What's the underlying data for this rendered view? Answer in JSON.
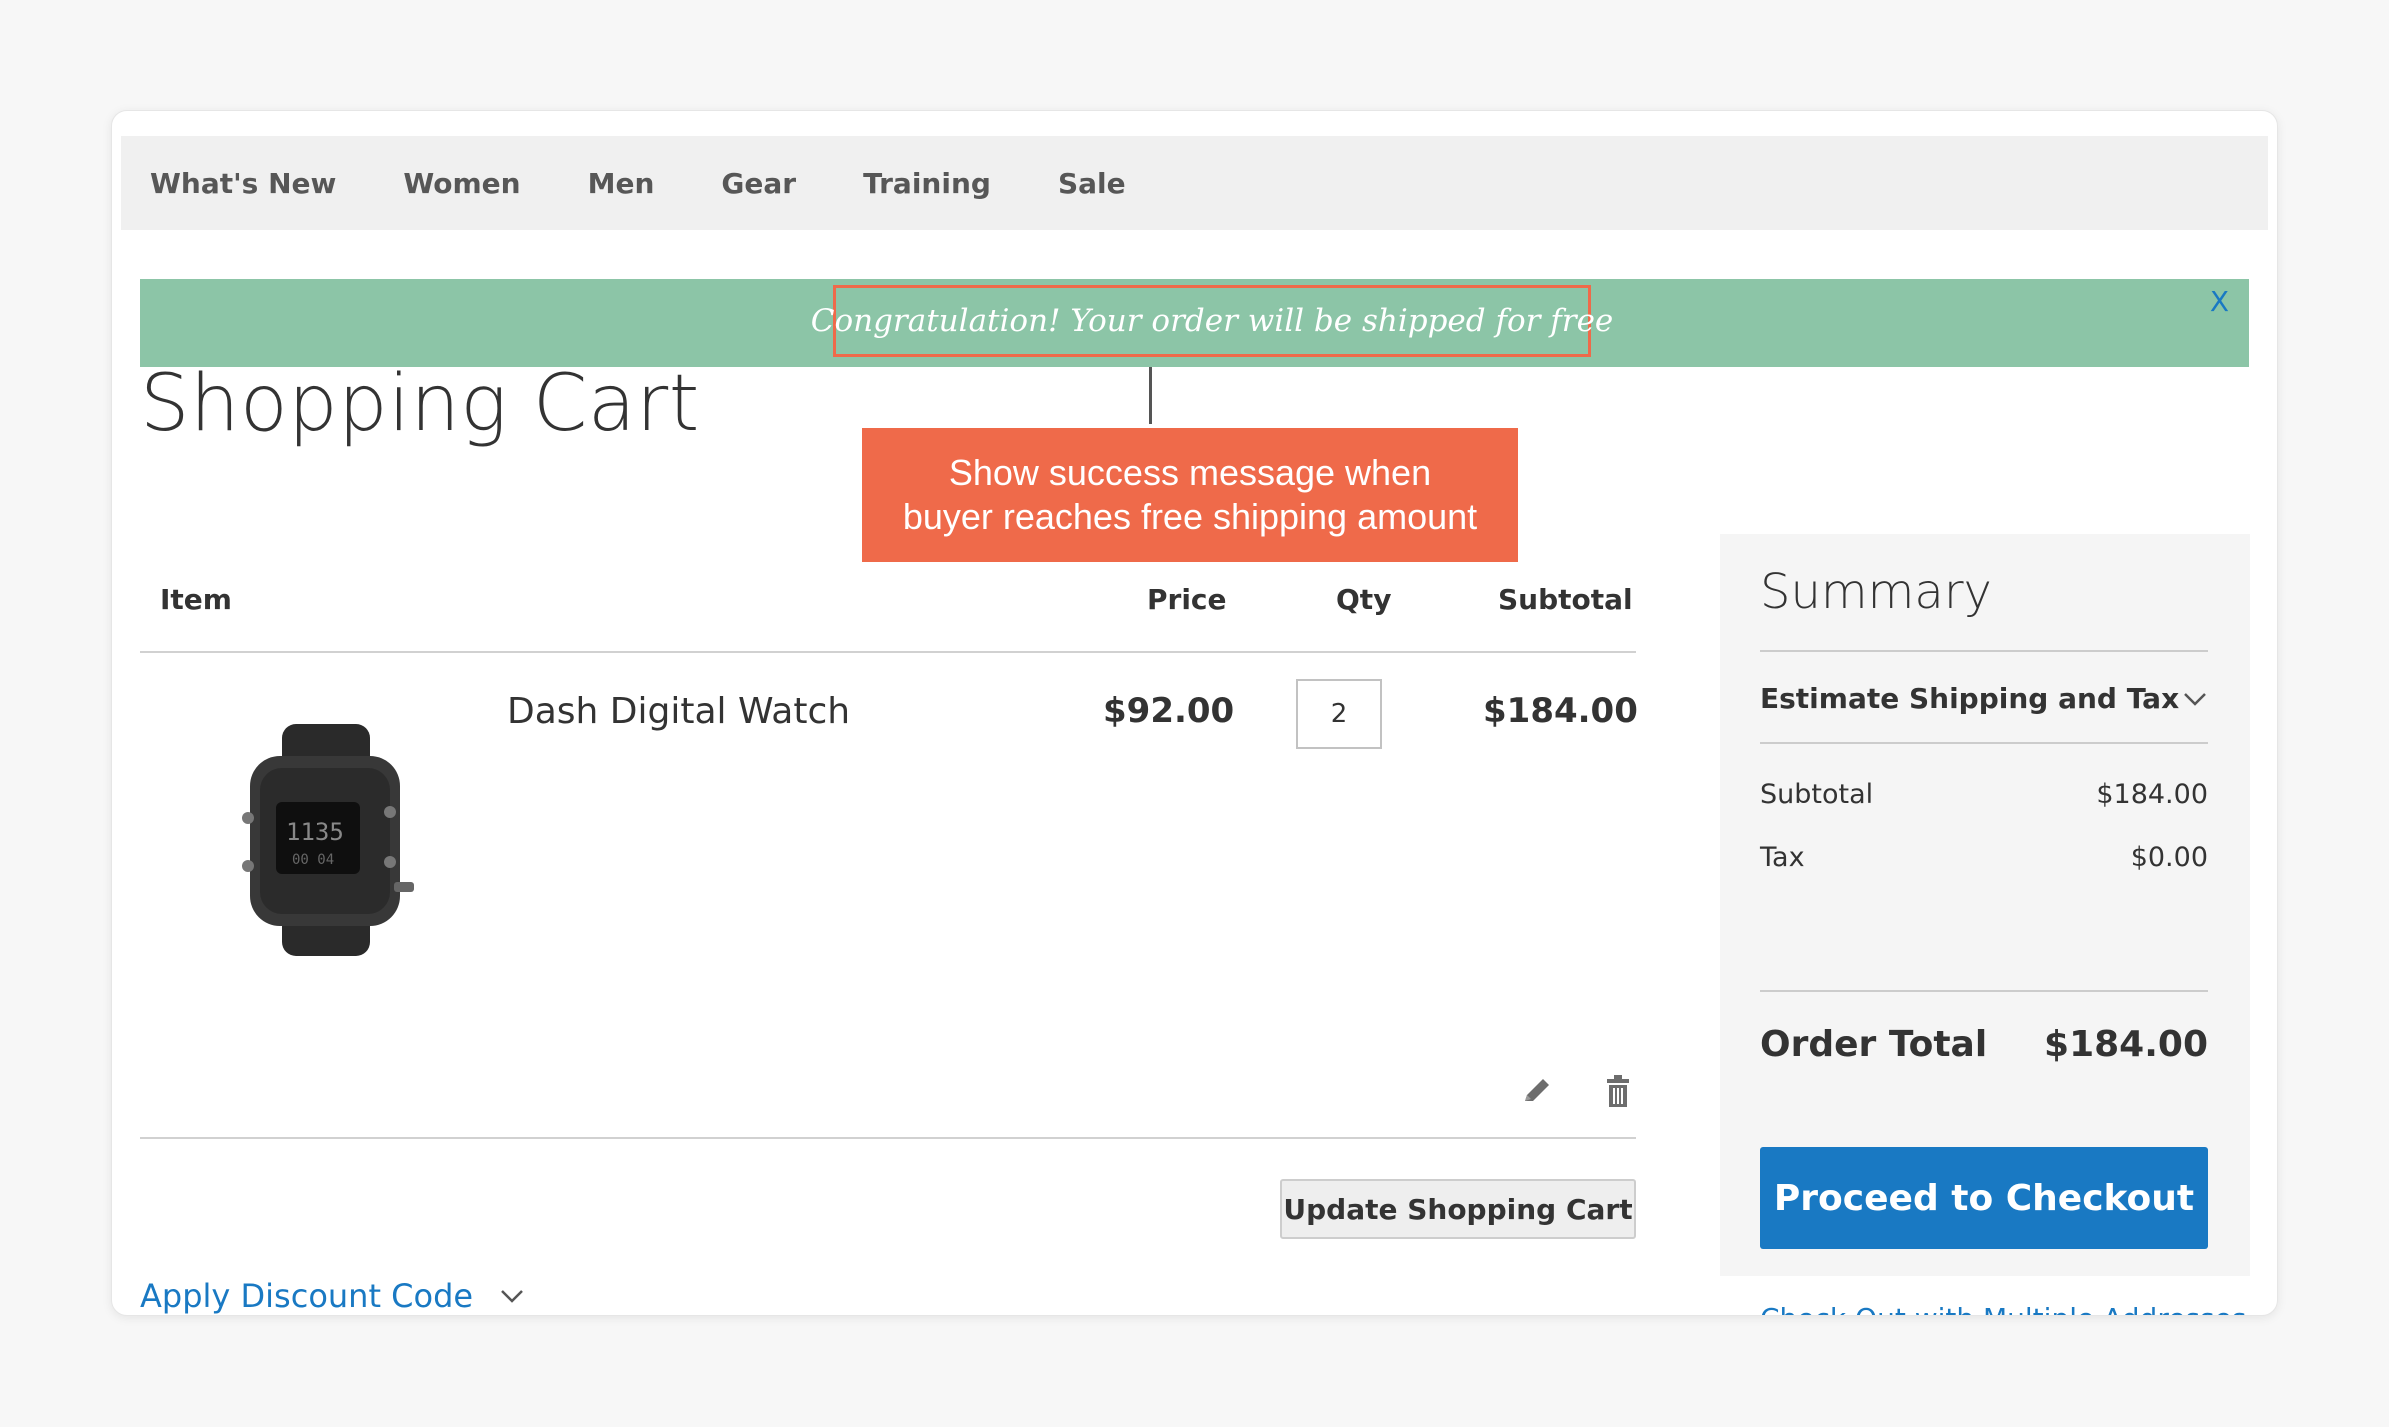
{
  "nav": {
    "items": [
      "What's New",
      "Women",
      "Men",
      "Gear",
      "Training",
      "Sale"
    ]
  },
  "banner": {
    "message": "Congratulation! Your order will be shipped for free",
    "close_label": "X",
    "color": "#8cc5a7"
  },
  "callout": {
    "line1": "Show success message when",
    "line2": "buyer reaches free shipping amount",
    "color": "#ef6a4a"
  },
  "page": {
    "title": "Shopping Cart"
  },
  "cart": {
    "headers": {
      "item": "Item",
      "price": "Price",
      "qty": "Qty",
      "subtotal": "Subtotal"
    },
    "items": [
      {
        "name": "Dash Digital Watch",
        "price": "$92.00",
        "qty": "2",
        "subtotal": "$184.00",
        "icon": "watch-image"
      }
    ],
    "update_button": "Update Shopping Cart",
    "discount_label": "Apply Discount Code"
  },
  "summary": {
    "title": "Summary",
    "estimate_label": "Estimate Shipping and Tax",
    "subtotal_label": "Subtotal",
    "subtotal_value": "$184.00",
    "tax_label": "Tax",
    "tax_value": "$0.00",
    "total_label": "Order Total",
    "total_value": "$184.00",
    "checkout_button": "Proceed to Checkout",
    "multi_address_link": "Check Out with Multiple Addresses",
    "accent_color": "#1979c3"
  }
}
